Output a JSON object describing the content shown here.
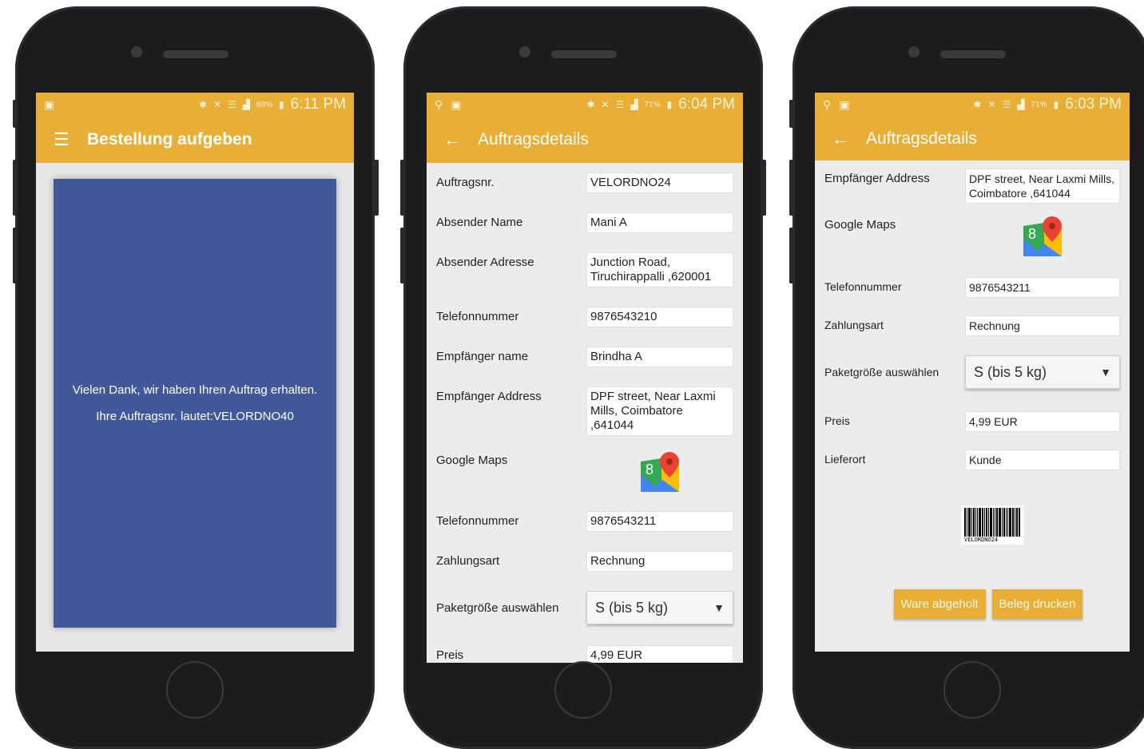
{
  "colors": {
    "accent": "#e8ae35",
    "panel_blue": "#41589a",
    "content_bg": "#ececec"
  },
  "phone1": {
    "status": {
      "battery_pct": "68%",
      "time": "6:11 PM"
    },
    "appbar": {
      "title": "Bestellung aufgeben",
      "nav_icon": "menu-icon"
    },
    "message": {
      "line1": "Vielen Dank, wir haben Ihren Auftrag erhalten.",
      "line2": "Ihre Auftragsnr. lautet:VELORDNO40"
    }
  },
  "phone2": {
    "status": {
      "battery_pct": "71%",
      "time": "6:04 PM"
    },
    "appbar": {
      "title": "Auftragsdetails",
      "nav_icon": "back-arrow-icon"
    },
    "fields": {
      "order_no": {
        "label": "Auftragsnr.",
        "value": "VELORDNO24"
      },
      "sender_name": {
        "label": "Absender Name",
        "value": "Mani A"
      },
      "sender_address": {
        "label": "Absender Adresse",
        "value": "Junction Road, Tiruchirappalli ,620001"
      },
      "sender_phone": {
        "label": "Telefonnummer",
        "value": "9876543210"
      },
      "recipient_name": {
        "label": "Empfänger name",
        "value": "Brindha A"
      },
      "recipient_address": {
        "label": "Empfänger Address",
        "value": "DPF street, Near Laxmi Mills, Coimbatore ,641044"
      },
      "maps": {
        "label": "Google Maps"
      },
      "recipient_phone": {
        "label": "Telefonnummer",
        "value": "9876543211"
      },
      "payment": {
        "label": "Zahlungsart",
        "value": "Rechnung"
      },
      "package_size": {
        "label": "Paketgröße auswählen",
        "value": "S (bis 5 kg)"
      },
      "price": {
        "label": "Preis",
        "value": "4,99 EUR"
      }
    }
  },
  "phone3": {
    "status": {
      "battery_pct": "71%",
      "time": "6:03 PM"
    },
    "appbar": {
      "title": "Auftragsdetails",
      "nav_icon": "back-arrow-icon"
    },
    "fields": {
      "recipient_address": {
        "label": "Empfänger Address",
        "value": "DPF street, Near Laxmi Mills, Coimbatore ,641044"
      },
      "maps": {
        "label": "Google Maps"
      },
      "recipient_phone": {
        "label": "Telefonnummer",
        "value": "9876543211"
      },
      "payment": {
        "label": "Zahlungsart",
        "value": "Rechnung"
      },
      "package_size": {
        "label": "Paketgröße auswählen",
        "value": "S (bis 5 kg)"
      },
      "price": {
        "label": "Preis",
        "value": "4,99 EUR"
      },
      "delivery": {
        "label": "Lieferort",
        "value": "Kunde"
      }
    },
    "barcode_text": "VELORDNO24",
    "buttons": {
      "picked_up": "Ware abgeholt",
      "print_receipt": "Beleg drucken"
    }
  }
}
